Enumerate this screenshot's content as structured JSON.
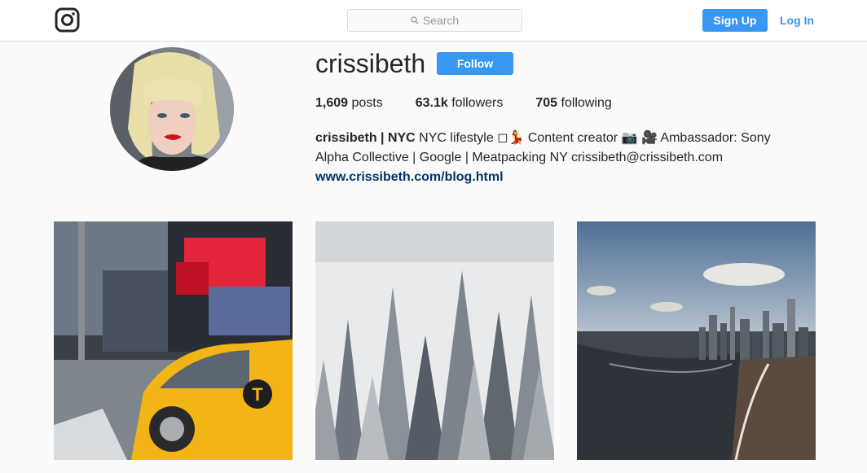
{
  "header": {
    "logo": "instagram-logo-icon",
    "search_placeholder": "Search",
    "search_icon": "search-icon",
    "signup_label": "Sign Up",
    "login_label": "Log In"
  },
  "profile": {
    "username": "crissibeth",
    "follow_label": "Follow",
    "stats": {
      "posts_count": "1,609",
      "posts_label": " posts",
      "followers_count": "63.1k",
      "followers_label": " followers",
      "following_count": "705",
      "following_label": " following"
    },
    "bio": {
      "name": "crissibeth | NYC",
      "text": " NYC lifestyle ◻💃 Content creator 📷 🎥 Ambassador: Sony Alpha Collective | Google | Meatpacking NY crissibeth@crissibeth.com",
      "link": "www.crissibeth.com/blog.html"
    }
  },
  "posts": [
    {
      "label": "taxi-times-square-photo"
    },
    {
      "label": "snowy-forest-photo"
    },
    {
      "label": "manhattan-skyline-photo"
    }
  ],
  "colors": {
    "accent": "#3897f0",
    "link": "#003569",
    "background": "#fafafa"
  }
}
